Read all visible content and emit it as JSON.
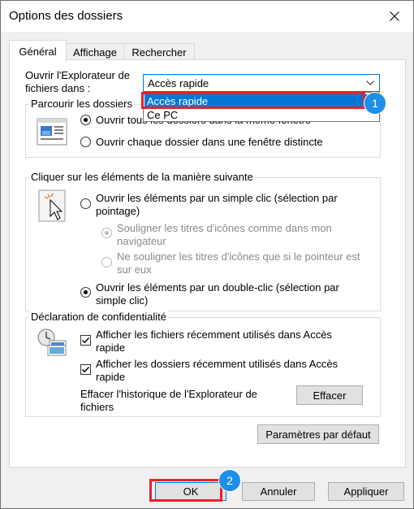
{
  "window": {
    "title": "Options des dossiers",
    "close_icon": "close-icon"
  },
  "tabs": [
    {
      "label": "Général",
      "active": true
    },
    {
      "label": "Affichage",
      "active": false
    },
    {
      "label": "Rechercher",
      "active": false
    }
  ],
  "explorer_open": {
    "label_line1": "Ouvrir l'Explorateur de",
    "label_line2": "fichiers dans :",
    "selected": "Accès rapide",
    "options": [
      "Accès rapide",
      "Ce PC"
    ]
  },
  "browse_folders": {
    "title": "Parcourir les dossiers",
    "option_same_window": "Ouvrir tous les dossiers dans la même fenêtre",
    "option_new_window": "Ouvrir chaque dossier dans une fenêtre distincte",
    "selected": "same_window"
  },
  "click_items": {
    "title": "Cliquer sur les éléments de la manière suivante",
    "single_click_line1": "Ouvrir les éléments par un simple clic (sélection par",
    "single_click_line2": "pointage)",
    "underline_browser_line1": "Souligner les titres d'icônes comme dans mon",
    "underline_browser_line2": "navigateur",
    "underline_pointing_line1": "Ne souligner les titres d'icônes que si le pointeur est",
    "underline_pointing_line2": "sur eux",
    "double_click_line1": "Ouvrir les éléments par un double-clic (sélection par",
    "double_click_line2": "simple clic)",
    "selected": "double_click"
  },
  "privacy": {
    "title": "Déclaration de confidentialité",
    "recent_files_line1": "Afficher les fichiers récemment utilisés dans Accès",
    "recent_files_line2": "rapide",
    "recent_files_checked": true,
    "recent_folders_line1": "Afficher les dossiers récemment utilisés dans Accès",
    "recent_folders_line2": "rapide",
    "recent_folders_checked": true,
    "clear_history_line1": "Effacer l'historique de l'Explorateur de",
    "clear_history_line2": "fichiers",
    "clear_button": "Effacer"
  },
  "restore_defaults_button": "Paramètres par défaut",
  "footer": {
    "ok": "OK",
    "cancel": "Annuler",
    "apply": "Appliquer"
  },
  "annotations": {
    "step1": "1",
    "step2": "2",
    "highlight_color": "#e8222a",
    "badge_color": "#1e8fe6"
  }
}
